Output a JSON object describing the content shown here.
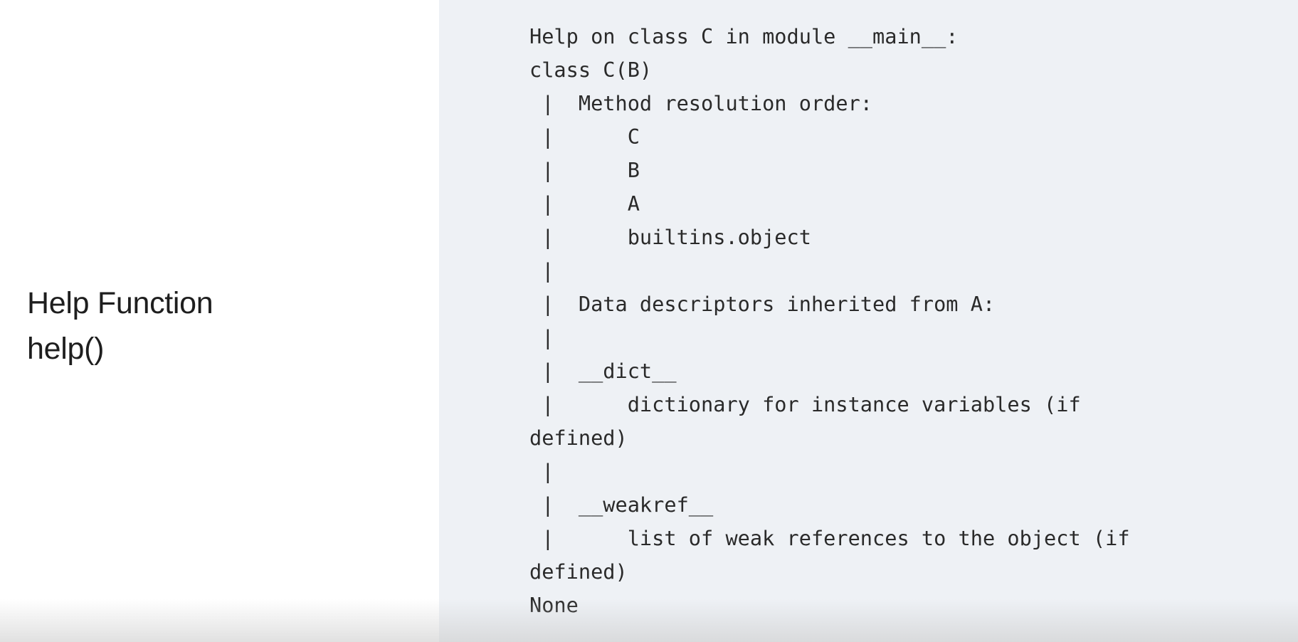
{
  "slide": {
    "title_line1": "Help Function",
    "title_line2": "help()"
  },
  "code": {
    "lines": [
      "Help on class C in module __main__:",
      "class C(B)",
      " |  Method resolution order:",
      " |      C",
      " |      B",
      " |      A",
      " |      builtins.object",
      " |",
      " |  Data descriptors inherited from A:",
      " |",
      " |  __dict__",
      " |      dictionary for instance variables (if",
      "defined)",
      " |",
      " |  __weakref__",
      " |      list of weak references to the object (if",
      "defined)",
      "None"
    ]
  },
  "colors": {
    "left_background": "#ffffff",
    "code_background": "#eef1f5",
    "text": "#2a2a2a"
  }
}
